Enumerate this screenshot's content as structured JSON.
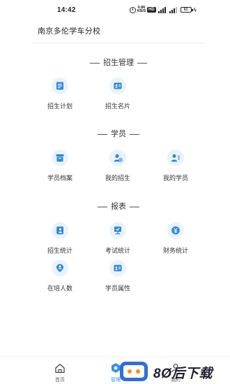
{
  "status_bar": {
    "time": "14:42",
    "speed_value": "0.86",
    "speed_unit": "KB/S",
    "hd_label": "HD",
    "battery": "61"
  },
  "header": {
    "title": "南京多伦学车分校"
  },
  "sections": [
    {
      "title": "招生管理",
      "items": [
        {
          "label": "招生计划",
          "icon": "plan-icon"
        },
        {
          "label": "招生名片",
          "icon": "card-icon"
        }
      ]
    },
    {
      "title": "学员",
      "items": [
        {
          "label": "学员档案",
          "icon": "archive-icon"
        },
        {
          "label": "我的招生",
          "icon": "add-user-icon"
        },
        {
          "label": "我的学员",
          "icon": "student-list-icon"
        }
      ]
    },
    {
      "title": "报表",
      "items": [
        {
          "label": "招生统计",
          "icon": "contacts-icon"
        },
        {
          "label": "考试统计",
          "icon": "exam-icon"
        },
        {
          "label": "财务统计",
          "icon": "yuan-icon"
        },
        {
          "label": "在培人数",
          "icon": "location-person-icon"
        },
        {
          "label": "学员属性",
          "icon": "id-card-icon"
        }
      ]
    }
  ],
  "tabbar": {
    "home": "首页",
    "manage": "管理",
    "mine": "我的"
  },
  "colors": {
    "accent": "#3a8ee6",
    "icon_bg": "#e9f3fb",
    "icon_fg": "#2f86d6"
  },
  "watermark": {
    "text": "8Ø后下载"
  }
}
